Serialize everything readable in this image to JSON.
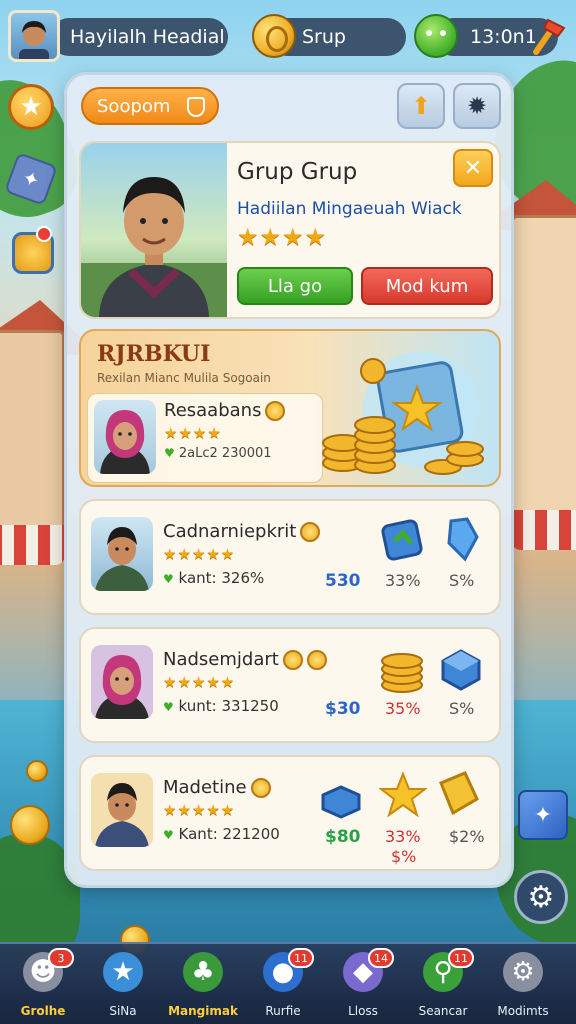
{
  "topbar": {
    "player_name": "Hayilalh Headial",
    "group_label": "Srup",
    "currency_value": "13:0n1"
  },
  "panel": {
    "tab_label": "Soopom",
    "profile": {
      "title": "Grup Grup",
      "subtitle": "Hadiilan Mingaeuah Wiack",
      "stars": "★★★★",
      "green_button": "Lla go",
      "red_button": "Mod kum"
    },
    "promo": {
      "title": "RJRBKUI",
      "subtitle": "Rexilan Mianc Mulila Sogoain",
      "name": "Resaabans",
      "stars": "★★★★",
      "stat": "2aLc2 230001"
    },
    "rows": [
      {
        "name": "Cadnarniepkrit",
        "stars": "★★★★★",
        "stat": "kant: 326%",
        "v1": "530",
        "v2": "33%",
        "v3": "S%",
        "v4": ""
      },
      {
        "name": "Nadsemjdart",
        "stars": "★★★★★",
        "stat": "kunt: 331250",
        "v1": "$30",
        "v2": "35%",
        "v3": "S%",
        "v4": ""
      },
      {
        "name": "Madetine",
        "stars": "★★★★★",
        "stat": "Kant: 221200",
        "v1": "$80",
        "v2": "33%",
        "v3": "$2%",
        "v4": "$%"
      }
    ]
  },
  "bottom_nav": [
    {
      "label": "Grolhe",
      "badge": "3",
      "icon": "paw-icon",
      "color": "#8a8fa0",
      "active": true
    },
    {
      "label": "SiNa",
      "badge": "",
      "icon": "star-icon",
      "color": "#3a8fd8",
      "active": false
    },
    {
      "label": "Mangimak",
      "badge": "",
      "icon": "palm-icon",
      "color": "#3a9a3a",
      "active": true
    },
    {
      "label": "Rurfie",
      "badge": "11",
      "icon": "planet-icon",
      "color": "#2d6fd0",
      "active": false
    },
    {
      "label": "Lloss",
      "badge": "14",
      "icon": "crystal-icon",
      "color": "#7a6ad0",
      "active": false
    },
    {
      "label": "Seancar",
      "badge": "11",
      "icon": "search-icon",
      "color": "#3aa03a",
      "active": false
    },
    {
      "label": "Modimts",
      "badge": "",
      "icon": "gear-icon",
      "color": "#8a8fa0",
      "active": false
    }
  ]
}
